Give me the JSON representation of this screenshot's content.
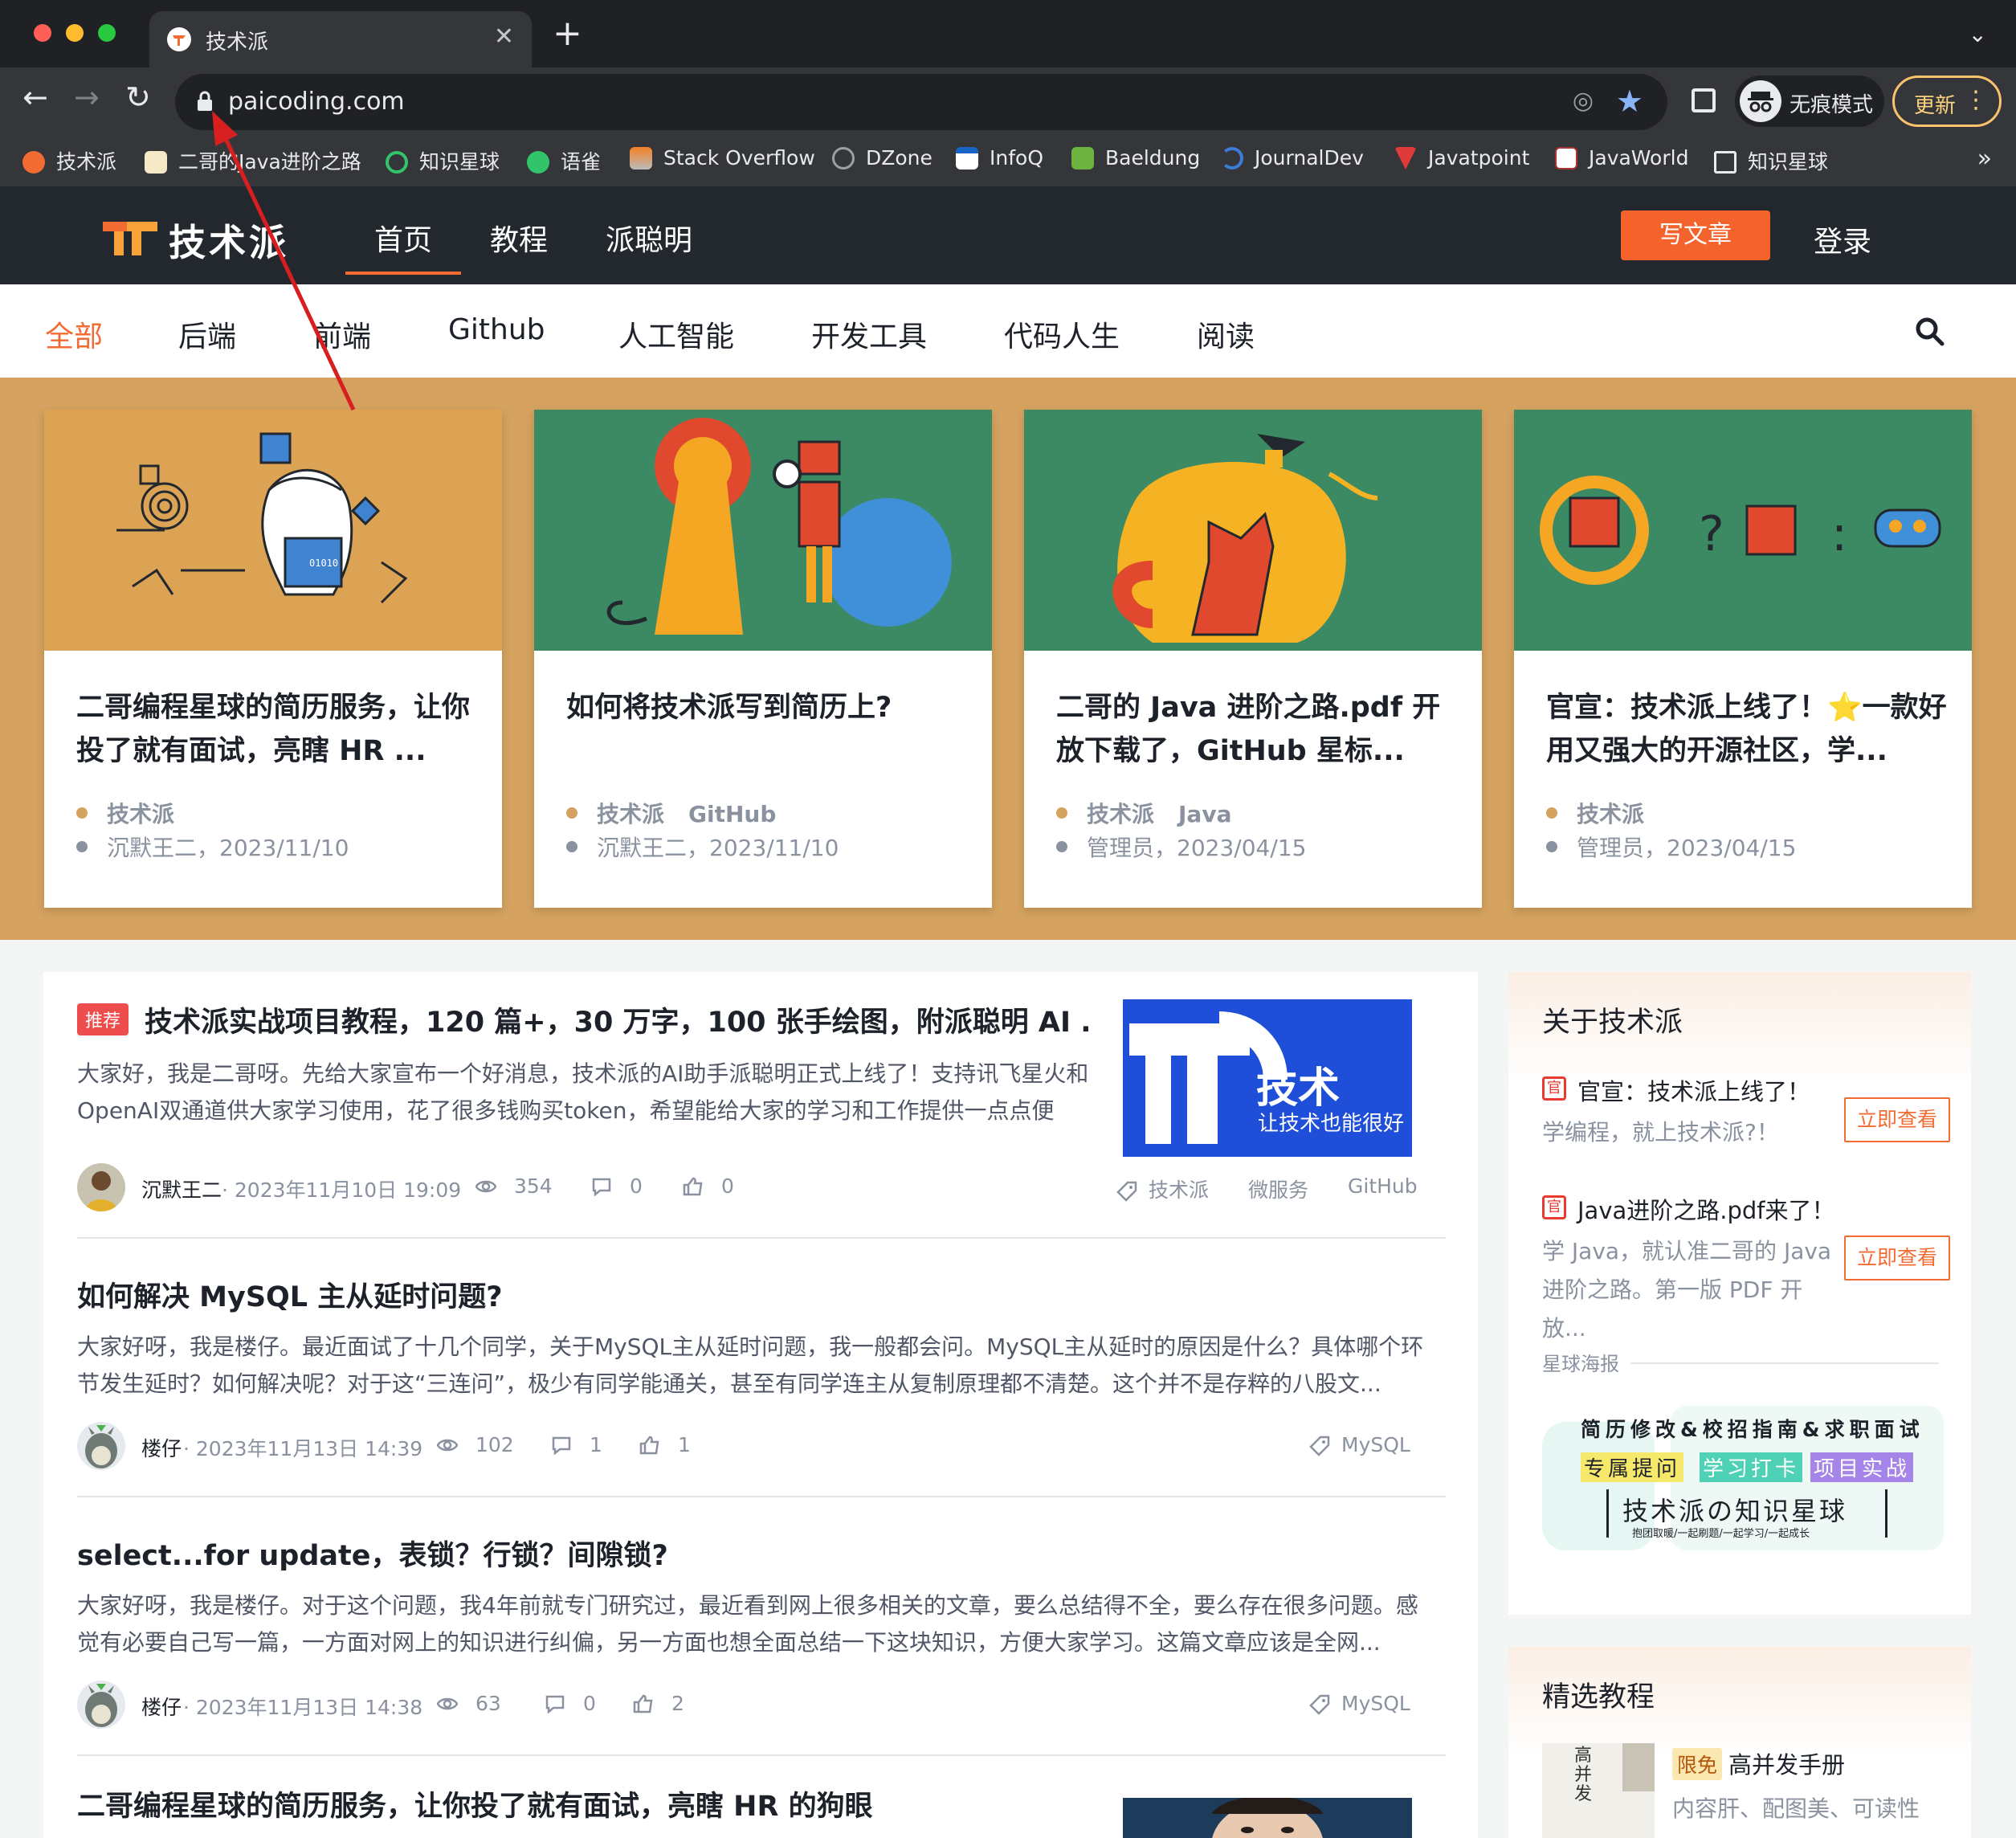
{
  "browser": {
    "tab_title": "技术派",
    "new_tab": "+",
    "tab_close": "✕",
    "tab_list": "⌄",
    "url": "paicoding.com",
    "incognito_label": "无痕模式",
    "update_label": "更新",
    "bookmarks": [
      "技术派",
      "二哥的Java进阶之路",
      "知识星球",
      "语雀",
      "Stack Overflow",
      "DZone",
      "InfoQ",
      "Baeldung",
      "JournalDev",
      "Javatpoint",
      "JavaWorld",
      "知识星球"
    ],
    "bookmarks_more": "»"
  },
  "site": {
    "logo_text": "技术派",
    "nav": [
      "首页",
      "教程",
      "派聪明"
    ],
    "write_label": "写文章",
    "login_label": "登录",
    "categories": [
      "全部",
      "后端",
      "前端",
      "Github",
      "人工智能",
      "开发工具",
      "代码人生",
      "阅读"
    ]
  },
  "featured": [
    {
      "title": "二哥编程星球的简历服务，让你投了就有面试，亮瞎 HR ...",
      "tags": [
        "技术派"
      ],
      "author_date": "沉默王二，2023/11/10"
    },
    {
      "title": "如何将技术派写到简历上?",
      "tags": [
        "技术派",
        "GitHub"
      ],
      "author_date": "沉默王二，2023/11/10"
    },
    {
      "title": "二哥的 Java 进阶之路.pdf 开放下载了，GitHub 星标...",
      "tags": [
        "技术派",
        "Java"
      ],
      "author_date": "管理员，2023/04/15"
    },
    {
      "title": "官宣：技术派上线了！⭐一款好用又强大的开源社区，学...",
      "tags": [
        "技术派"
      ],
      "author_date": "管理员，2023/04/15"
    }
  ],
  "articles": [
    {
      "badge": "推荐",
      "title": "技术派实战项目教程，120 篇+，30 万字，100 张手绘图，附派聪明 AI ...",
      "body": "大家好，我是二哥呀。先给大家宣布一个好消息，技术派的AI助手派聪明正式上线了！支持讯飞星火和OpenAI双通道供大家学习使用，花了很多钱购买token，希望能给大家的学习和工作提供一点点便利...",
      "author": "沉默王二",
      "date": "· 2023年11月10日 19:09",
      "views": "354",
      "comments": "0",
      "likes": "0",
      "tags": [
        "技术派",
        "微服务",
        "GitHub"
      ],
      "thumb_title": "技术",
      "thumb_sub": "让技术也能很好"
    },
    {
      "badge": "",
      "title": "如何解决 MySQL 主从延时问题?",
      "body": "大家好呀，我是楼仔。最近面试了十几个同学，关于MySQL主从延时问题，我一般都会问。MySQL主从延时的原因是什么？具体哪个环节发生延时？如何解决呢？对于这“三连问”，极少有同学能通关，甚至有同学连主从复制原理都不清楚。这个并不是存粹的八股文...",
      "author": "楼仔",
      "date": "· 2023年11月13日 14:39",
      "views": "102",
      "comments": "1",
      "likes": "1",
      "tags": [
        "MySQL"
      ]
    },
    {
      "badge": "",
      "title": "select...for update，表锁？行锁？间隙锁?",
      "body": "大家好呀，我是楼仔。对于这个问题，我4年前就专门研究过，最近看到网上很多相关的文章，要么总结得不全，要么存在很多问题。感觉有必要自己写一篇，一方面对网上的知识进行纠偏，另一方面也想全面总结一下这块知识，方便大家学习。这篇文章应该是全网...",
      "author": "楼仔",
      "date": "· 2023年11月13日 14:38",
      "views": "63",
      "comments": "0",
      "likes": "2",
      "tags": [
        "MySQL"
      ]
    },
    {
      "badge": "",
      "title": "二哥编程星球的简历服务，让你投了就有面试，亮瞎 HR 的狗眼"
    }
  ],
  "sidebar": {
    "about_title": "关于技术派",
    "items": [
      {
        "title": "官宣：技术派上线了！",
        "desc": "学编程，就上技术派?！",
        "button": "立即查看"
      },
      {
        "title": "Java进阶之路.pdf来了！",
        "desc": "学 Java，就认准二哥的 Java 进阶之路。第一版 PDF 开放...",
        "button": "立即查看"
      }
    ],
    "poster_label": "星球海报",
    "poster": {
      "line1": "简历修改&校招指南&求职面试",
      "tags": [
        "专属提问",
        "学习打卡",
        "项目实战"
      ],
      "main": "技术派の知识星球",
      "sub": "抱团取暖/一起刷题/一起学习/一起成长"
    },
    "tutorial_title": "精选教程",
    "tutorial": {
      "badge": "限免",
      "name": "高并发手册",
      "desc": "内容肝、配图美、可读性",
      "cover_text": "高并发"
    }
  },
  "colors": {
    "accent": "#f26b32",
    "featured_bg": "#d5a25f",
    "header_bg": "#23272e"
  }
}
